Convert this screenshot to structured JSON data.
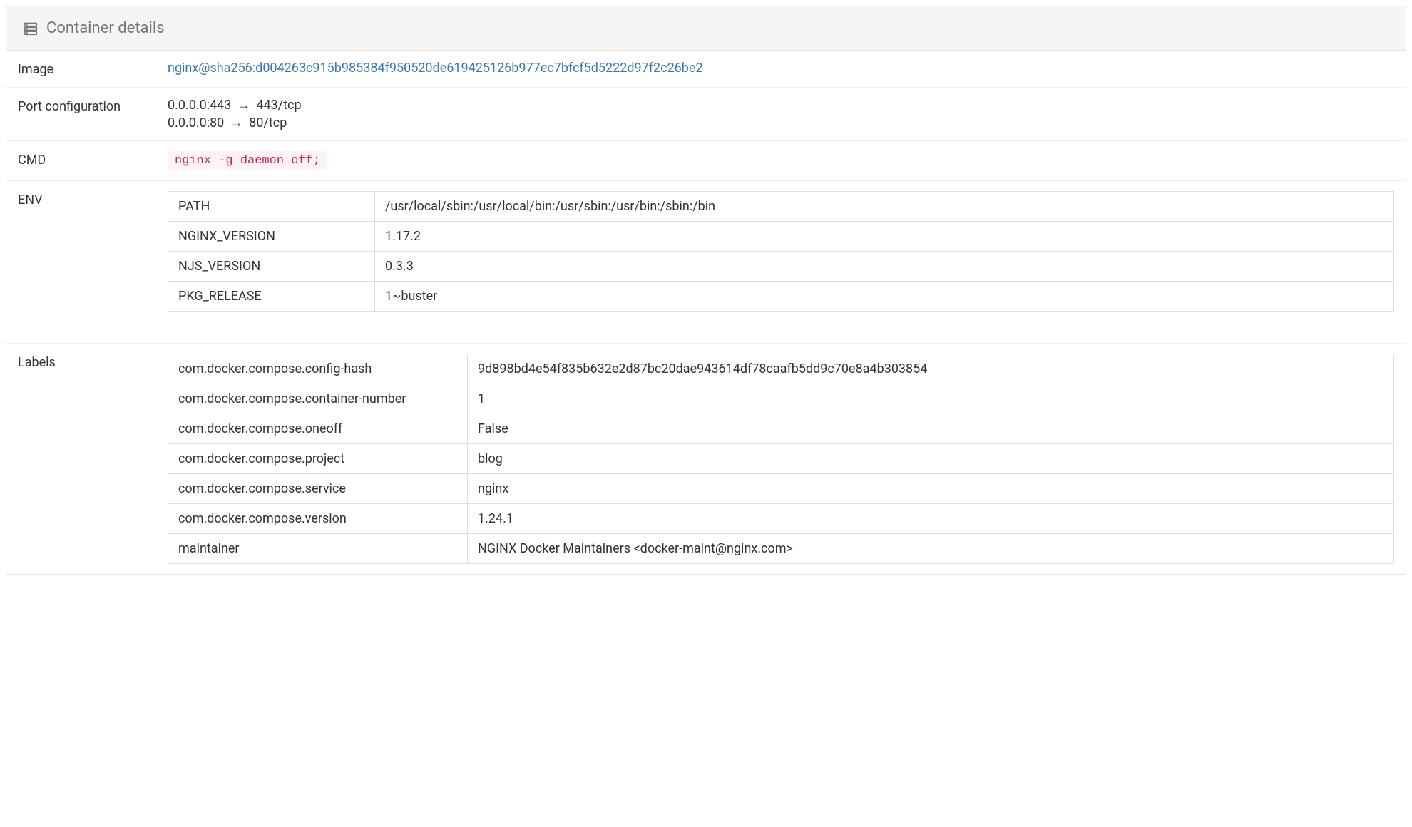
{
  "header": {
    "title": "Container details"
  },
  "details": {
    "image_label": "Image",
    "image_value": "nginx@sha256:d004263c915b985384f950520de619425126b977ec7bfcf5d5222d97f2c26be2",
    "port_label": "Port configuration",
    "ports": [
      {
        "host": "0.0.0.0:443",
        "container": "443/tcp"
      },
      {
        "host": "0.0.0.0:80",
        "container": "80/tcp"
      }
    ],
    "cmd_label": "CMD",
    "cmd_value": "nginx -g daemon off;",
    "env_label": "ENV",
    "env": [
      {
        "key": "PATH",
        "value": "/usr/local/sbin:/usr/local/bin:/usr/sbin:/usr/bin:/sbin:/bin"
      },
      {
        "key": "NGINX_VERSION",
        "value": "1.17.2"
      },
      {
        "key": "NJS_VERSION",
        "value": "0.3.3"
      },
      {
        "key": "PKG_RELEASE",
        "value": "1~buster"
      }
    ],
    "labels_label": "Labels",
    "labels": [
      {
        "key": "com.docker.compose.config-hash",
        "value": "9d898bd4e54f835b632e2d87bc20dae943614df78caafb5dd9c70e8a4b303854"
      },
      {
        "key": "com.docker.compose.container-number",
        "value": "1"
      },
      {
        "key": "com.docker.compose.oneoff",
        "value": "False"
      },
      {
        "key": "com.docker.compose.project",
        "value": "blog"
      },
      {
        "key": "com.docker.compose.service",
        "value": "nginx"
      },
      {
        "key": "com.docker.compose.version",
        "value": "1.24.1"
      },
      {
        "key": "maintainer",
        "value": "NGINX Docker Maintainers <docker-maint@nginx.com>"
      }
    ]
  }
}
